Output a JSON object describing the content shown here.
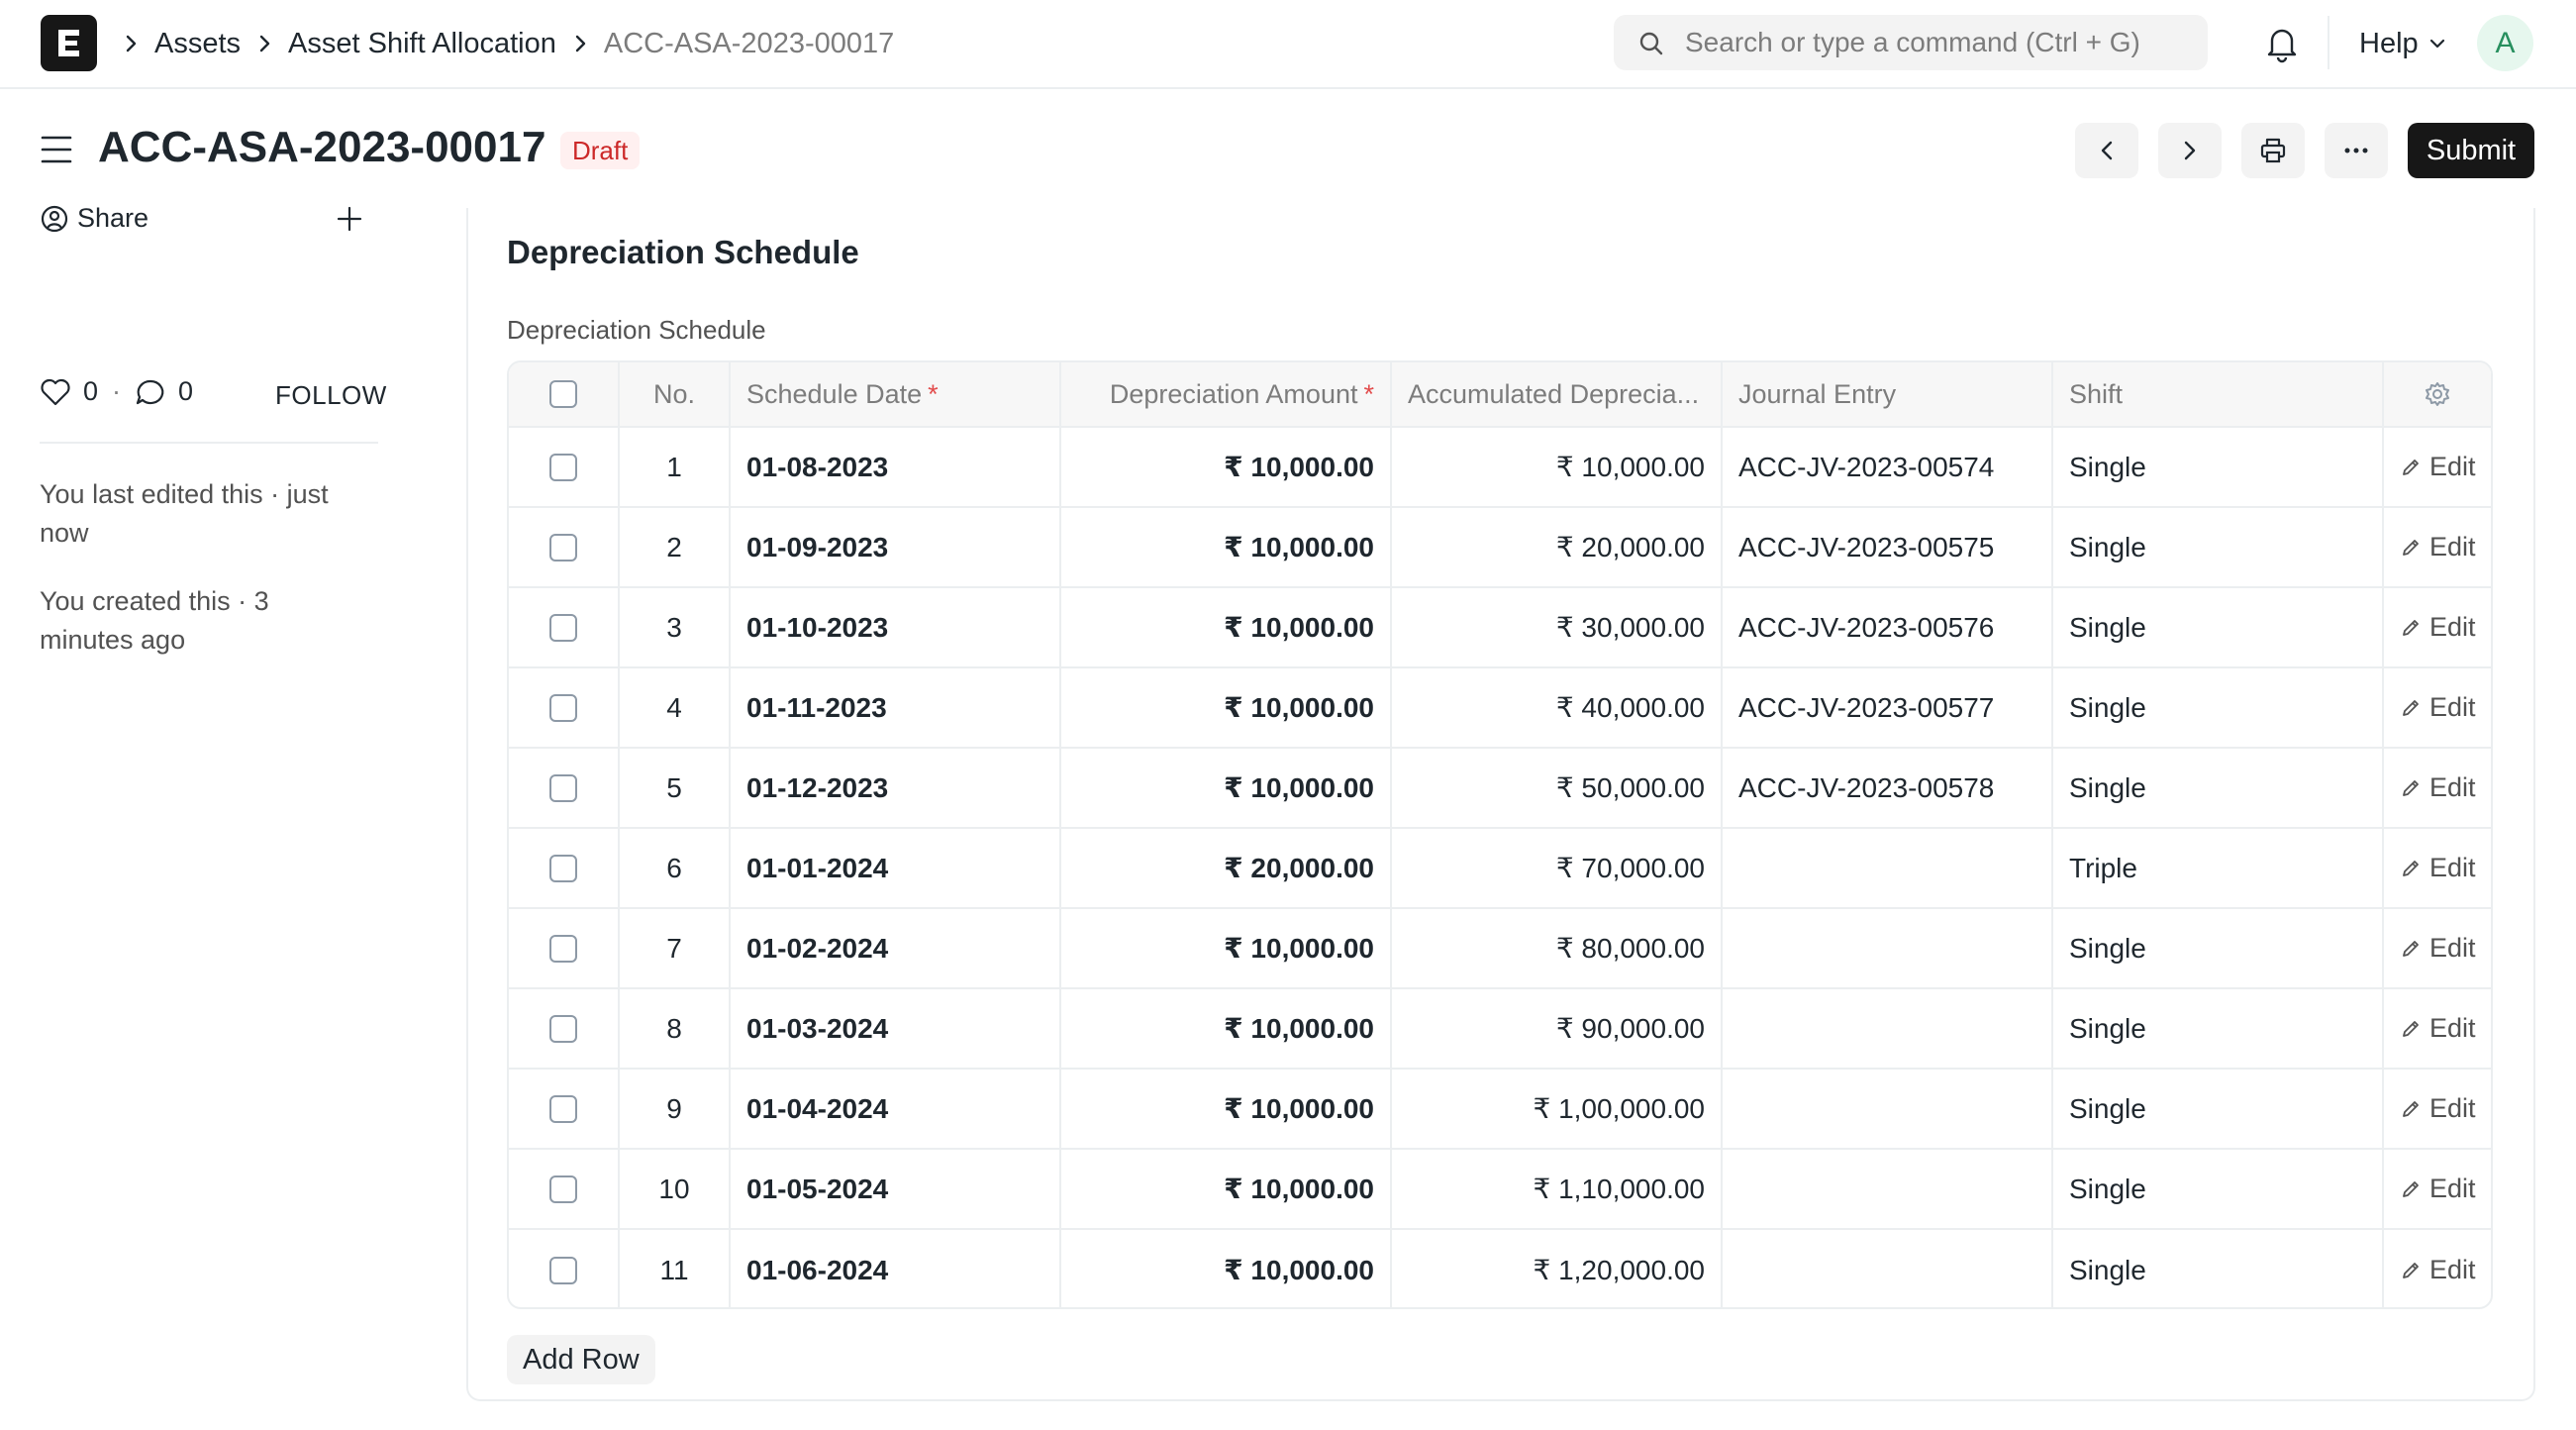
{
  "breadcrumbs": [
    "Assets",
    "Asset Shift Allocation",
    "ACC-ASA-2023-00017"
  ],
  "search": {
    "placeholder": "Search or type a command (Ctrl + G)"
  },
  "navbar": {
    "help_label": "Help",
    "avatar_initial": "A"
  },
  "page": {
    "title": "ACC-ASA-2023-00017",
    "status": "Draft",
    "submit_label": "Submit"
  },
  "sidebar": {
    "share_label": "Share",
    "likes": "0",
    "comments": "0",
    "follow_label": "FOLLOW",
    "last_edited": "You last edited this · just now",
    "created": "You created this · 3 minutes ago"
  },
  "section": {
    "title": "Depreciation Schedule",
    "field_label": "Depreciation Schedule",
    "add_row_label": "Add Row"
  },
  "table": {
    "columns": {
      "no": "No.",
      "schedule_date": "Schedule Date",
      "depreciation_amount": "Depreciation Amount",
      "accumulated": "Accumulated Deprecia...",
      "journal_entry": "Journal Entry",
      "shift": "Shift"
    },
    "required_mark": "*",
    "edit_label": "Edit",
    "rows": [
      {
        "no": "1",
        "date": "01-08-2023",
        "amount": "₹ 10,000.00",
        "accumulated": "₹ 10,000.00",
        "journal": "ACC-JV-2023-00574",
        "shift": "Single"
      },
      {
        "no": "2",
        "date": "01-09-2023",
        "amount": "₹ 10,000.00",
        "accumulated": "₹ 20,000.00",
        "journal": "ACC-JV-2023-00575",
        "shift": "Single"
      },
      {
        "no": "3",
        "date": "01-10-2023",
        "amount": "₹ 10,000.00",
        "accumulated": "₹ 30,000.00",
        "journal": "ACC-JV-2023-00576",
        "shift": "Single"
      },
      {
        "no": "4",
        "date": "01-11-2023",
        "amount": "₹ 10,000.00",
        "accumulated": "₹ 40,000.00",
        "journal": "ACC-JV-2023-00577",
        "shift": "Single"
      },
      {
        "no": "5",
        "date": "01-12-2023",
        "amount": "₹ 10,000.00",
        "accumulated": "₹ 50,000.00",
        "journal": "ACC-JV-2023-00578",
        "shift": "Single"
      },
      {
        "no": "6",
        "date": "01-01-2024",
        "amount": "₹ 20,000.00",
        "accumulated": "₹ 70,000.00",
        "journal": "",
        "shift": "Triple"
      },
      {
        "no": "7",
        "date": "01-02-2024",
        "amount": "₹ 10,000.00",
        "accumulated": "₹ 80,000.00",
        "journal": "",
        "shift": "Single"
      },
      {
        "no": "8",
        "date": "01-03-2024",
        "amount": "₹ 10,000.00",
        "accumulated": "₹ 90,000.00",
        "journal": "",
        "shift": "Single"
      },
      {
        "no": "9",
        "date": "01-04-2024",
        "amount": "₹ 10,000.00",
        "accumulated": "₹ 1,00,000.00",
        "journal": "",
        "shift": "Single"
      },
      {
        "no": "10",
        "date": "01-05-2024",
        "amount": "₹ 10,000.00",
        "accumulated": "₹ 1,10,000.00",
        "journal": "",
        "shift": "Single"
      },
      {
        "no": "11",
        "date": "01-06-2024",
        "amount": "₹ 10,000.00",
        "accumulated": "₹ 1,20,000.00",
        "journal": "",
        "shift": "Single"
      }
    ]
  },
  "colors": {
    "draft_badge_bg": "#fff0f0",
    "draft_badge_text": "#cc2929",
    "primary_button": "#171717",
    "border": "#ebeef0"
  }
}
